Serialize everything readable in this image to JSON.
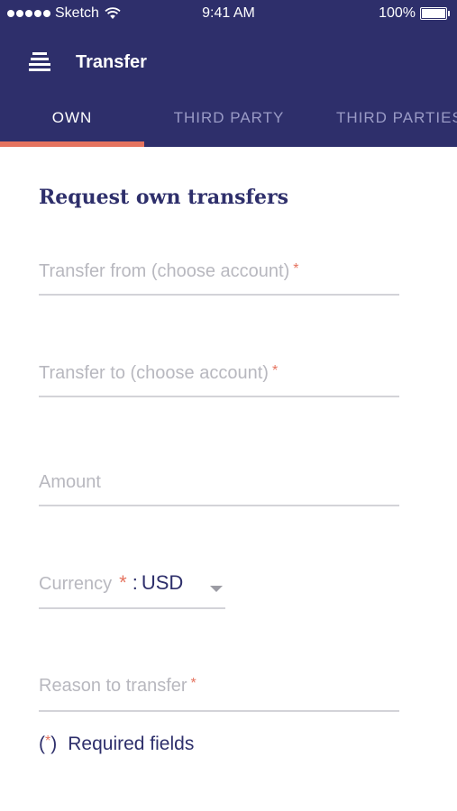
{
  "status_bar": {
    "carrier": "Sketch",
    "time": "9:41 AM",
    "battery": "100%"
  },
  "app_bar": {
    "title": "Transfer",
    "menu_icon": "menu-icon"
  },
  "tabs": [
    {
      "label": "OWN",
      "active": true
    },
    {
      "label": "THIRD PARTY",
      "active": false
    },
    {
      "label": "THIRD PARTIES",
      "active": false
    }
  ],
  "form": {
    "title": "Request own transfers",
    "transfer_from": {
      "placeholder": "Transfer from (choose account)",
      "required_mark": "*"
    },
    "transfer_to": {
      "placeholder": "Transfer to (choose account)",
      "required_mark": "*"
    },
    "amount": {
      "placeholder": "Amount"
    },
    "currency": {
      "label": "Currency",
      "required_mark": "*",
      "separator": ":",
      "value": "USD"
    },
    "reason": {
      "placeholder": "Reason to transfer",
      "required_mark": "*"
    },
    "required_note": {
      "open": "(",
      "star": "*",
      "close": ")",
      "text": "Required fields"
    }
  },
  "colors": {
    "header_bg": "#2e2f6b",
    "accent": "#e5735f",
    "inactive_tab": "#9a9bc6",
    "placeholder": "#b8b8bf"
  }
}
